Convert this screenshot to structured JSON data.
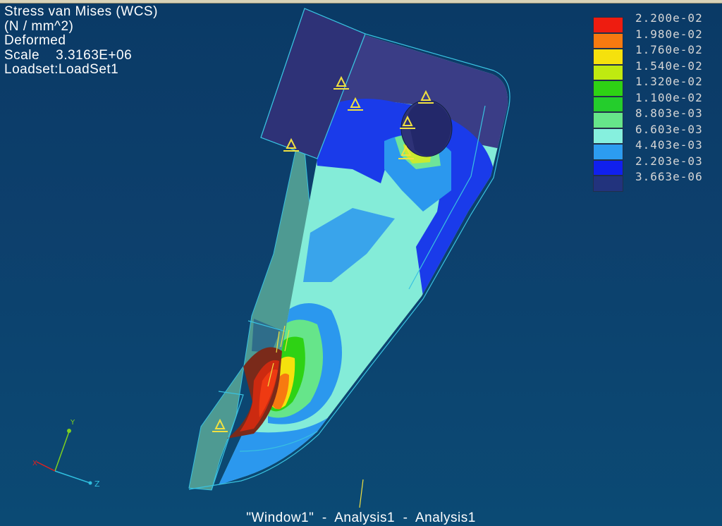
{
  "info": {
    "result": "Stress van Mises (WCS)",
    "units": "(N / mm^2)",
    "display": "Deformed",
    "scale": "Scale    3.3163E+06",
    "loadset": "Loadset:LoadSet1"
  },
  "legend": {
    "labels": [
      "2.200e-02",
      "1.980e-02",
      "1.760e-02",
      "1.540e-02",
      "1.320e-02",
      "1.100e-02",
      "8.803e-03",
      "6.603e-03",
      "4.403e-03",
      "2.203e-03",
      "3.663e-06"
    ],
    "colors": [
      "#ee1c10",
      "#f77a10",
      "#f5e10d",
      "#bfea10",
      "#2ed214",
      "#24cd2c",
      "#66e58a",
      "#86f0de",
      "#2c9cf0",
      "#1020ee",
      "#22337d"
    ]
  },
  "triad": {
    "x": "X",
    "y": "Y",
    "z": "Z"
  },
  "caption": "\"Window1\"  -  Analysis1  -  Analysis1",
  "colors": {
    "background": "#0b3e6c",
    "outline": "#39c2e0",
    "constraint": "#f0e040"
  }
}
